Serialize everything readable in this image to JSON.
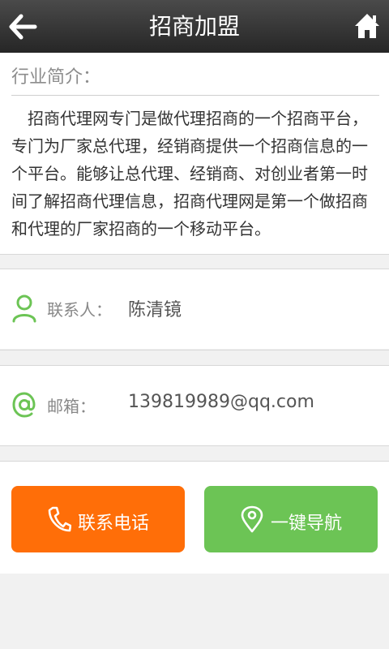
{
  "header": {
    "title": "招商加盟",
    "back_icon": "back-arrow-icon",
    "home_icon": "home-icon"
  },
  "intro": {
    "heading": "行业简介：",
    "text": "招商代理网专门是做代理招商的一个招商平台，专门为厂家总代理，经销商提供一个招商信息的一个平台。能够让总代理、经销商、对创业者第一时间了解招商代理信息，招商代理网是第一个做招商和代理的厂家招商的一个移动平台。"
  },
  "contact": {
    "label": "联系人：",
    "value": "陈清镜",
    "icon": "person-icon"
  },
  "email": {
    "label": "邮箱：",
    "value": "139819989@qq.com",
    "icon": "at-icon"
  },
  "buttons": {
    "call": {
      "label": "联系电话",
      "icon": "phone-icon",
      "color": "#ff6e08"
    },
    "navigate": {
      "label": "一键导航",
      "icon": "location-pin-icon",
      "color": "#6cc455"
    }
  },
  "colors": {
    "accent_green": "#6cc455",
    "accent_orange": "#ff6e08",
    "header_bg": "#333333"
  }
}
